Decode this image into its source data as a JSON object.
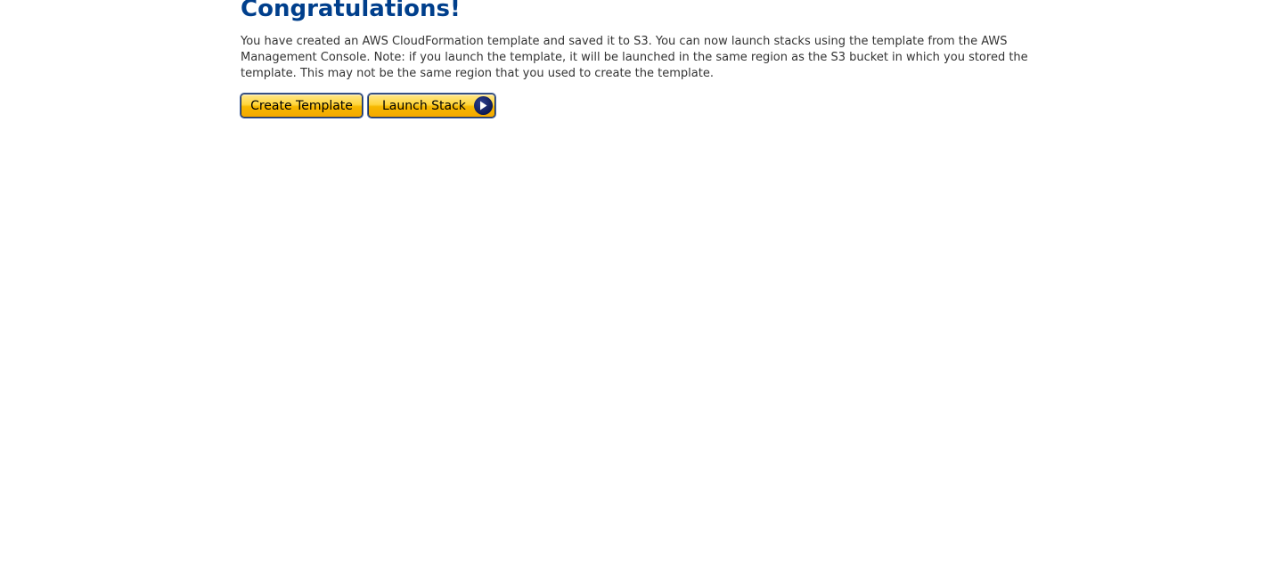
{
  "header": {
    "title": "Congratulations!"
  },
  "main": {
    "message": "You have created an AWS CloudFormation template and saved it to S3. You can now launch stacks using the template from the AWS Management Console. Note: if you launch the template, it will be launched in the same region as the S3 bucket in which you stored the template. This may not be the same region that you used to create the template."
  },
  "buttons": {
    "create_template_label": "Create Template",
    "launch_stack_label": "Launch Stack",
    "launch_icon": "play-arrow-icon"
  },
  "colors": {
    "title": "#003f8c",
    "text": "#333333",
    "button_gold": "#ffd53c",
    "button_border": "#1c2f59"
  }
}
